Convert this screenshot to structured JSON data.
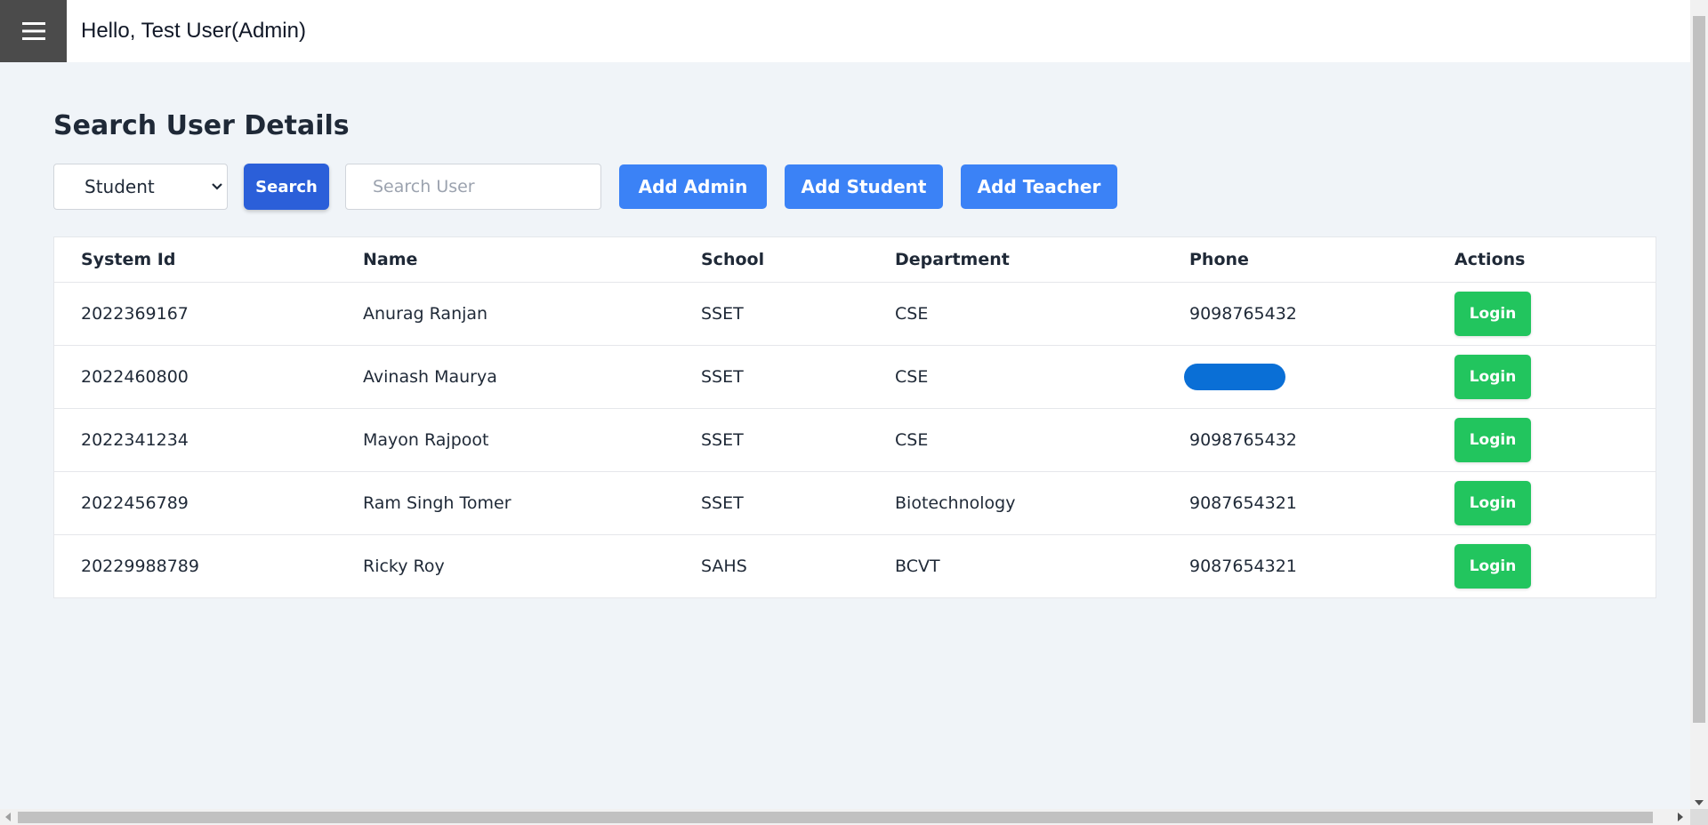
{
  "header": {
    "greeting": "Hello, Test User(Admin)",
    "menu_icon": "hamburger-menu-icon"
  },
  "page": {
    "title": "Search User Details"
  },
  "toolbar": {
    "role_select_value": "Student",
    "search_label": "Search",
    "search_placeholder": "Search User",
    "add_admin_label": "Add Admin",
    "add_student_label": "Add Student",
    "add_teacher_label": "Add Teacher"
  },
  "table": {
    "headers": [
      "System Id",
      "Name",
      "School",
      "Department",
      "Phone",
      "Actions"
    ],
    "action_label": "Login",
    "rows": [
      {
        "system_id": "2022369167",
        "name": "Anurag Ranjan",
        "school": "SSET",
        "department": "CSE",
        "phone": "9098765432"
      },
      {
        "system_id": "2022460800",
        "name": "Avinash Maurya",
        "school": "SSET",
        "department": "CSE",
        "phone": ""
      },
      {
        "system_id": "2022341234",
        "name": "Mayon Rajpoot",
        "school": "SSET",
        "department": "CSE",
        "phone": "9098765432"
      },
      {
        "system_id": "2022456789",
        "name": "Ram Singh Tomer",
        "school": "SSET",
        "department": "Biotechnology",
        "phone": "9087654321"
      },
      {
        "system_id": "20229988789",
        "name": "Ricky Roy",
        "school": "SAHS",
        "department": "BCVT",
        "phone": "9087654321"
      }
    ]
  },
  "colors": {
    "search_button": "#2b5fd9",
    "add_buttons": "#3b82f6",
    "login_buttons": "#22c55e",
    "redaction": "#0a6fd6"
  }
}
